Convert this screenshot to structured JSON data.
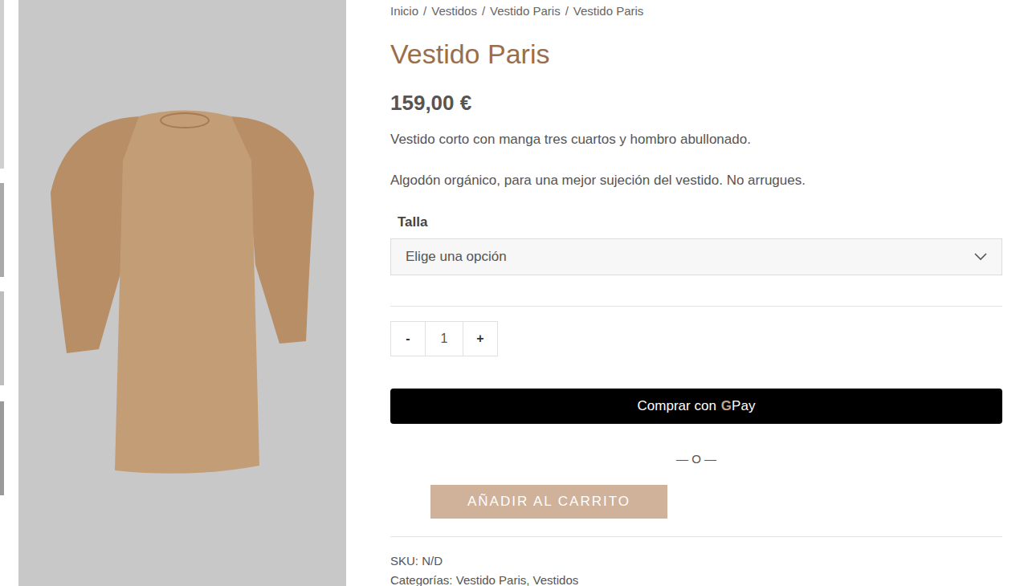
{
  "breadcrumb": {
    "items": [
      "Inicio",
      "Vestidos",
      "Vestido Paris",
      "Vestido Paris"
    ],
    "separator": "/"
  },
  "product": {
    "title": "Vestido Paris",
    "price": "159,00 €",
    "description": [
      "Vestido corto con manga tres cuartos y hombro abullonado.",
      "Algodón orgánico, para una mejor sujeción del vestido. No arrugues."
    ]
  },
  "size": {
    "label": "Talla",
    "placeholder": "Elige una opción"
  },
  "quantity": {
    "minus": "-",
    "value": "1",
    "plus": "+"
  },
  "gpay_button": {
    "label": "Comprar con",
    "logo": "G",
    "brand": "Pay"
  },
  "or_divider": "— O —",
  "add_to_cart": "AÑADIR AL CARRITO",
  "meta": {
    "sku": "SKU: N/D",
    "categories": "Categorías: Vestido Paris, Vestidos"
  }
}
